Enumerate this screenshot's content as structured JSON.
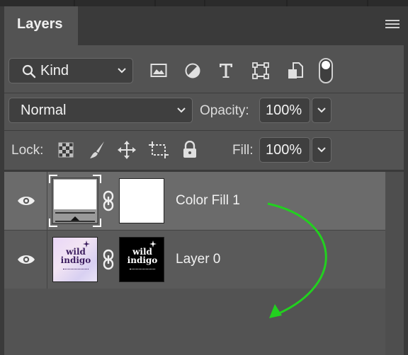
{
  "panel": {
    "tab_label": "Layers"
  },
  "filter": {
    "kind_label": "Kind",
    "filter_icons": [
      "image-filter-icon",
      "adjustment-filter-icon",
      "type-filter-icon",
      "shape-filter-icon",
      "smart-object-filter-icon",
      "filter-toggle-icon"
    ]
  },
  "blend": {
    "mode": "Normal",
    "opacity_label": "Opacity:",
    "opacity_value": "100%"
  },
  "lock": {
    "label": "Lock:",
    "fill_label": "Fill:",
    "fill_value": "100%"
  },
  "layers": [
    {
      "name": "Color Fill 1",
      "selected": true,
      "thumb_text": "",
      "mask_text": ""
    },
    {
      "name": "Layer 0",
      "selected": false,
      "thumb_text": "wild indigo",
      "mask_text": "wild indigo"
    }
  ],
  "colors": {
    "annotation_arrow": "#22d11f",
    "selected_row": "#6b6b6b",
    "panel_bg": "#535353"
  }
}
